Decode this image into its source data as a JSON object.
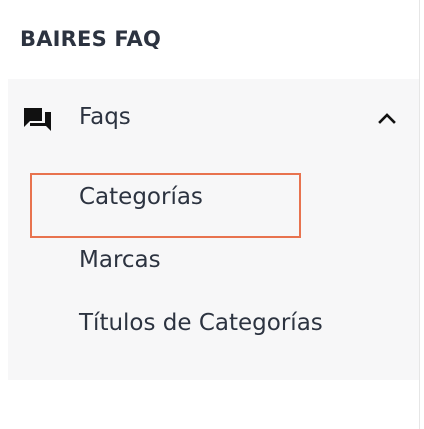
{
  "brand": {
    "title": "BAIRES FAQ"
  },
  "menu": {
    "label": "Faqs",
    "icon": "forum-icon",
    "expanded": true,
    "chevron_icon": "chevron-up-icon",
    "items": [
      {
        "label": "Categorías",
        "highlighted": true
      },
      {
        "label": "Marcas"
      },
      {
        "label": "Títulos de Categorías"
      }
    ]
  },
  "colors": {
    "text": "#2c3340",
    "panel_bg": "#f7f7f8",
    "highlight_border": "#e8734f"
  }
}
